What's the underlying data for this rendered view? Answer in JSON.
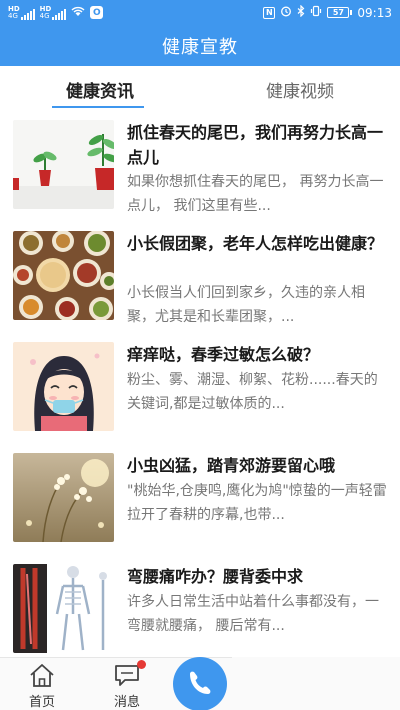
{
  "status_bar": {
    "sim1": "HD",
    "sim2": "HD",
    "net1": "4G",
    "net2": "4G",
    "app_badge": "O",
    "nfc": "N",
    "battery": "57",
    "time": "09:13"
  },
  "header": {
    "title": "健康宣教"
  },
  "tabs": [
    {
      "label": "健康资讯",
      "active": true
    },
    {
      "label": "健康视频",
      "active": false
    }
  ],
  "articles": [
    {
      "title": "抓住春天的尾巴，我们再努力长高一点儿",
      "summary": "如果你想抓住春天的尾巴，  再努力长高一点儿，   我们这里有些...",
      "thumb": "sprout-plants"
    },
    {
      "title": "小长假团聚，老年人怎样吃出健康？",
      "summary": "小长假当人们回到家乡，久违的亲人相聚，尤其是和长辈团聚，...",
      "thumb": "family-dinner"
    },
    {
      "title": "痒痒哒，春季过敏怎么破？",
      "summary": "粉尘、雾、潮湿、柳絮、花粉......春天的关键词,都是过敏体质的...",
      "thumb": "anime-girl-mask"
    },
    {
      "title": "小虫凶猛，踏青郊游要留心哦",
      "summary": "\"桃始华,仓庚鸣,鹰化为鸠\"惊蛰的一声轻雷拉开了春耕的序幕,也带...",
      "thumb": "spring-flowers"
    },
    {
      "title": "弯腰痛咋办？腰背委中求",
      "summary": "许多人日常生活中站着什么事都没有，一弯腰就腰痛，  腰后常有...",
      "thumb": "anatomy-skeleton"
    }
  ],
  "bottom_nav": {
    "home_label": "首页",
    "messages_label": "消息",
    "messages_has_badge": true
  },
  "colors": {
    "primary": "#3f97ee",
    "badge": "#e53935"
  }
}
